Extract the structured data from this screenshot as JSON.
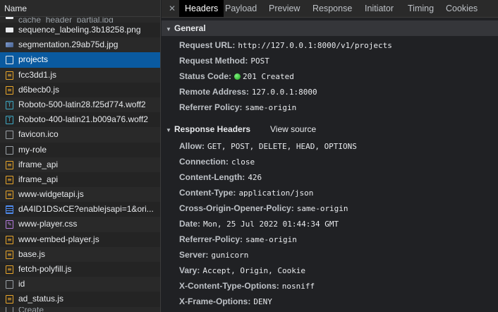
{
  "left": {
    "header": "Name",
    "rows": [
      {
        "name": "cache_header_partial.jpg",
        "icon": "img",
        "partial": true
      },
      {
        "name": "sequence_labeling.3b18258.png",
        "icon": "img"
      },
      {
        "name": "segmentation.29ab75d.jpg",
        "icon": "img2"
      },
      {
        "name": "projects",
        "icon": "doc",
        "selected": true
      },
      {
        "name": "fcc3dd1.js",
        "icon": "js"
      },
      {
        "name": "d6becb0.js",
        "icon": "js"
      },
      {
        "name": "Roboto-500-latin28.f25d774.woff2",
        "icon": "font"
      },
      {
        "name": "Roboto-400-latin21.b009a76.woff2",
        "icon": "font"
      },
      {
        "name": "favicon.ico",
        "icon": "plain"
      },
      {
        "name": "my-role",
        "icon": "plain"
      },
      {
        "name": "iframe_api",
        "icon": "js"
      },
      {
        "name": "iframe_api",
        "icon": "js"
      },
      {
        "name": "www-widgetapi.js",
        "icon": "js"
      },
      {
        "name": "dA4ID1DSxCE?enablejsapi=1&ori...",
        "icon": "xhr"
      },
      {
        "name": "www-player.css",
        "icon": "css"
      },
      {
        "name": "www-embed-player.js",
        "icon": "js"
      },
      {
        "name": "base.js",
        "icon": "js"
      },
      {
        "name": "fetch-polyfill.js",
        "icon": "js"
      },
      {
        "name": "id",
        "icon": "plain"
      },
      {
        "name": "ad_status.js",
        "icon": "js"
      },
      {
        "name": "Create",
        "icon": "plain",
        "partial": true
      }
    ]
  },
  "tabs": {
    "close": "✕",
    "items": [
      {
        "label": "Headers",
        "active": true
      },
      {
        "label": "Payload"
      },
      {
        "label": "Preview"
      },
      {
        "label": "Response"
      },
      {
        "label": "Initiator"
      },
      {
        "label": "Timing"
      },
      {
        "label": "Cookies"
      }
    ]
  },
  "general": {
    "title": "General",
    "rows": [
      {
        "key": "Request URL:",
        "value": "http://127.0.0.1:8000/v1/projects"
      },
      {
        "key": "Request Method:",
        "value": "POST"
      },
      {
        "key": "Status Code:",
        "value": "201 Created",
        "status_dot": true
      },
      {
        "key": "Remote Address:",
        "value": "127.0.0.1:8000"
      },
      {
        "key": "Referrer Policy:",
        "value": "same-origin"
      }
    ]
  },
  "response_headers": {
    "title": "Response Headers",
    "view_source": "View source",
    "rows": [
      {
        "key": "Allow:",
        "value": "GET, POST, DELETE, HEAD, OPTIONS"
      },
      {
        "key": "Connection:",
        "value": "close"
      },
      {
        "key": "Content-Length:",
        "value": "426"
      },
      {
        "key": "Content-Type:",
        "value": "application/json"
      },
      {
        "key": "Cross-Origin-Opener-Policy:",
        "value": "same-origin"
      },
      {
        "key": "Date:",
        "value": "Mon, 25 Jul 2022 01:44:34 GMT"
      },
      {
        "key": "Referrer-Policy:",
        "value": "same-origin"
      },
      {
        "key": "Server:",
        "value": "gunicorn"
      },
      {
        "key": "Vary:",
        "value": "Accept, Origin, Cookie"
      },
      {
        "key": "X-Content-Type-Options:",
        "value": "nosniff"
      },
      {
        "key": "X-Frame-Options:",
        "value": "DENY"
      }
    ]
  },
  "colors": {
    "selected_row": "#0a5aa0",
    "status_ok": "#1aa31a",
    "js_icon": "#e8a52a",
    "font_icon": "#3ea8c4",
    "css_icon": "#b77de0"
  }
}
